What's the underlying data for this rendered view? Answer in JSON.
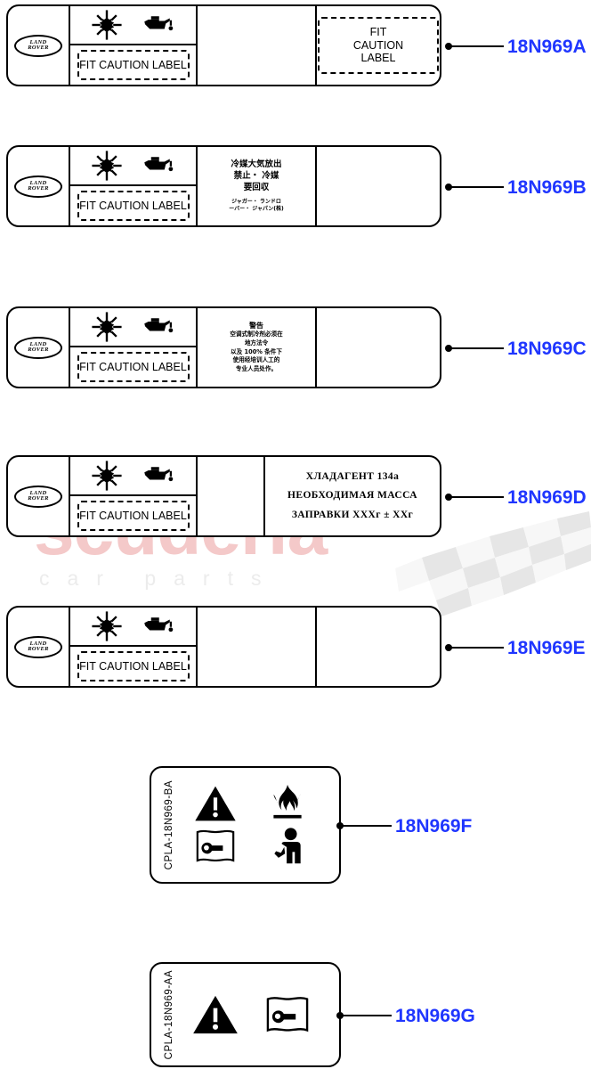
{
  "diagram": {
    "title": "Caution Label Parts Diagram",
    "accent_part_number_color": "#1f36ff",
    "line_color": "#000000",
    "background": "#ffffff"
  },
  "watermark": {
    "main_text": "scuderia",
    "sub_text": "car parts",
    "main_color": "#f4c9c9",
    "sub_color": "#ececec"
  },
  "common": {
    "brand_line1": "LAND",
    "brand_line2": "ROVER",
    "fit_caution_label": "FIT CAUTION LABEL",
    "fit_caution_label_multiline": "FIT CAUTION LABEL",
    "snowflake_icon": "ac-snowflake-icon",
    "oilcan_icon": "oil-can-icon"
  },
  "labels": [
    {
      "part_number": "18N969A",
      "variant": "A",
      "has_logo": true,
      "has_icons": true,
      "cell3_text": "",
      "cell4_dashed_text": "FIT CAUTION LABEL",
      "cell4_has_dashed_box": true
    },
    {
      "part_number": "18N969B",
      "variant": "B",
      "has_logo": true,
      "has_icons": true,
      "jp_line1": "冷媒大気放出",
      "jp_line2": "禁止・ 冷媒",
      "jp_line3": "要回収",
      "jp_sub1": "ジャガー・ ランドロ",
      "jp_sub2": "ーバー・ ジャパン(株)",
      "cell4_has_dashed_box": false
    },
    {
      "part_number": "18N969C",
      "variant": "C",
      "has_logo": true,
      "has_icons": true,
      "cn_title": "警告",
      "cn_line1": "空调式制冷剂必须在",
      "cn_line2": "地方法令",
      "cn_line3": "以及 100% 条件下",
      "cn_line4": "使用经培训人工的",
      "cn_line5": "专业人员处作。",
      "cell4_has_dashed_box": false
    },
    {
      "part_number": "18N969D",
      "variant": "D",
      "has_logo": true,
      "has_icons": true,
      "ru_line1": "ХЛАДАГЕНТ  134a",
      "ru_line2": "НЕОБХОДИМАЯ  МАССА",
      "ru_line3": "ЗАПРАВКИ XXXг ± XXг",
      "cell4_has_dashed_box": false
    },
    {
      "part_number": "18N969E",
      "variant": "E",
      "has_logo": true,
      "has_icons": true,
      "cell3_text": "",
      "cell4_has_dashed_box": false
    }
  ],
  "warning_labels": [
    {
      "part_number": "18N969F",
      "code": "CPLA-18N969-BA",
      "icons": [
        "warning-triangle-icon",
        "flame-icon",
        "manual-book-wrench-icon",
        "person-service-icon"
      ]
    },
    {
      "part_number": "18N969G",
      "code": "CPLA-18N969-AA",
      "icons": [
        "warning-triangle-icon",
        "manual-book-wrench-icon"
      ]
    }
  ]
}
